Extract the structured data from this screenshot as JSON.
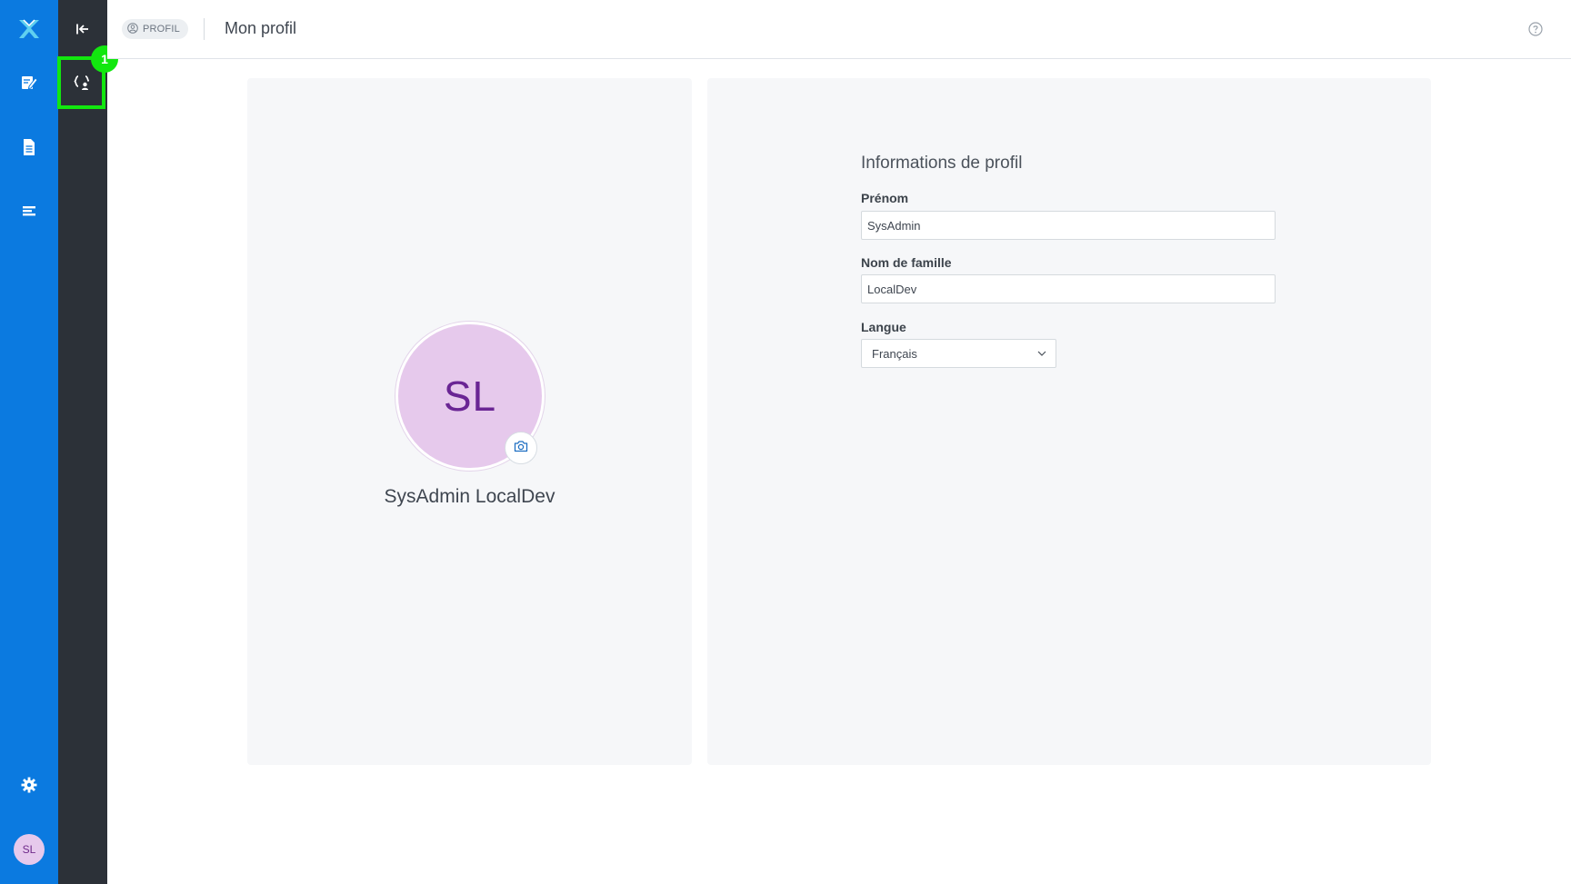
{
  "rail": {
    "logo_icon": "app-logo-icon",
    "items": [
      {
        "icon": "edit-document-icon"
      },
      {
        "icon": "document-icon"
      },
      {
        "icon": "list-icon"
      }
    ],
    "settings_icon": "gear-icon",
    "user_initials": "SL"
  },
  "subrail": {
    "collapse_icon": "collapse-left-icon",
    "active_item_icon": "user-settings-icon",
    "marker_number": "1"
  },
  "header": {
    "chip_label": "PROFIL",
    "title": "Mon profil",
    "help_icon": "help-circle-icon"
  },
  "profile_card": {
    "initials": "SL",
    "full_name": "SysAdmin LocalDev",
    "camera_icon": "camera-icon"
  },
  "profile_info": {
    "section_title": "Informations de profil",
    "first_name_label": "Prénom",
    "first_name_value": "SysAdmin",
    "last_name_label": "Nom de famille",
    "last_name_value": "LocalDev",
    "language_label": "Langue",
    "language_value": "Français"
  },
  "colors": {
    "rail_blue": "#0b7ae0",
    "subrail_dark": "#2c3138",
    "highlight_green": "#12e70f",
    "avatar_bg": "#e6c9ec",
    "avatar_text": "#6a2594"
  }
}
